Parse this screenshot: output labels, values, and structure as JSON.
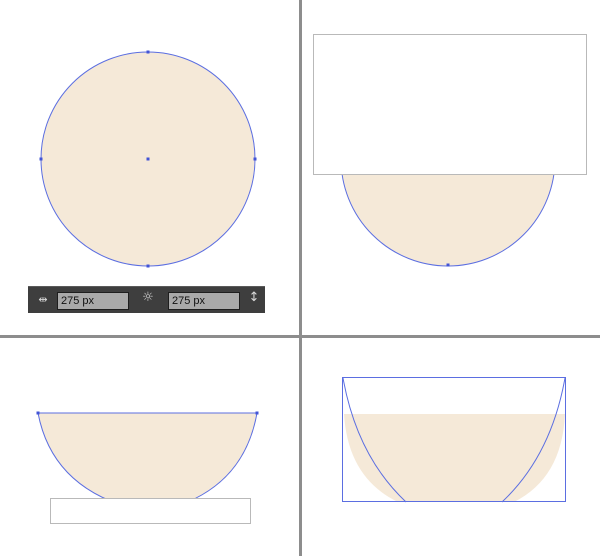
{
  "colors": {
    "fill": "#f5e9d8",
    "path": "#5b6ee1",
    "anchor": "#4254d6",
    "guide": "#b9b9b9",
    "divider": "#8d8d8d",
    "toolbar_bg": "#3e3e3e",
    "input_bg": "#a9a9a9"
  },
  "dimensions_toolbar": {
    "width_icon": "width-arrows-icon",
    "width_value": "275 px",
    "link_icon": "link-constrain-icon",
    "height_value": "275 px",
    "height_icon": "height-arrows-icon"
  }
}
